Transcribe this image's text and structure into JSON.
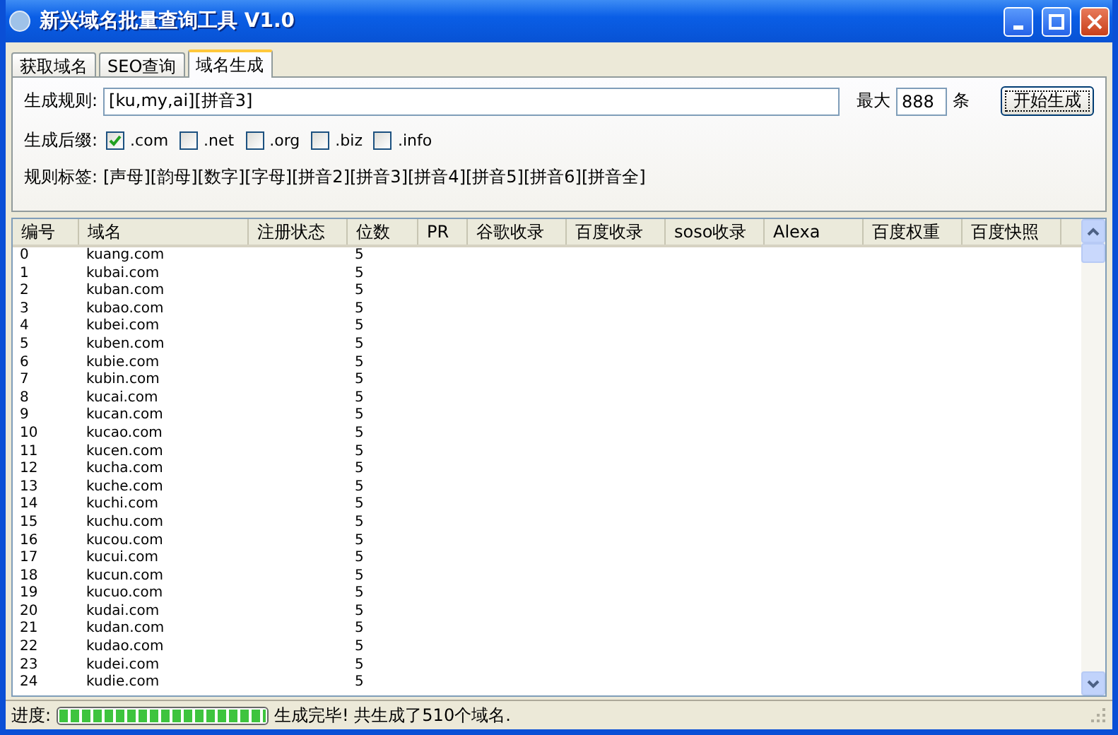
{
  "window": {
    "title": "新兴域名批量查询工具 V1.0"
  },
  "tabs": [
    {
      "label": "获取域名",
      "selected": false
    },
    {
      "label": "SEO查询",
      "selected": false
    },
    {
      "label": "域名生成",
      "selected": true
    }
  ],
  "rule": {
    "label": "生成规则:",
    "value": "[ku,my,ai][拼音3]",
    "max_label": "最大",
    "max_value": "888",
    "unit": "条",
    "button": "开始生成"
  },
  "suffixes": {
    "label": "生成后缀:",
    "items": [
      {
        "label": ".com",
        "checked": true
      },
      {
        "label": ".net",
        "checked": false
      },
      {
        "label": ".org",
        "checked": false
      },
      {
        "label": ".biz",
        "checked": false
      },
      {
        "label": ".info",
        "checked": false
      }
    ]
  },
  "tags": {
    "label": "规则标签:",
    "text": "[声母][韵母][数字][字母][拼音2][拼音3][拼音4][拼音5][拼音6][拼音全]"
  },
  "table": {
    "columns": [
      "编号",
      "域名",
      "注册状态",
      "位数",
      "PR",
      "谷歌收录",
      "百度收录",
      "soso收录",
      "Alexa",
      "百度权重",
      "百度快照"
    ],
    "rows": [
      {
        "no": "0",
        "domain": "kuang.com",
        "digits": "5"
      },
      {
        "no": "1",
        "domain": "kubai.com",
        "digits": "5"
      },
      {
        "no": "2",
        "domain": "kuban.com",
        "digits": "5"
      },
      {
        "no": "3",
        "domain": "kubao.com",
        "digits": "5"
      },
      {
        "no": "4",
        "domain": "kubei.com",
        "digits": "5"
      },
      {
        "no": "5",
        "domain": "kuben.com",
        "digits": "5"
      },
      {
        "no": "6",
        "domain": "kubie.com",
        "digits": "5"
      },
      {
        "no": "7",
        "domain": "kubin.com",
        "digits": "5"
      },
      {
        "no": "8",
        "domain": "kucai.com",
        "digits": "5"
      },
      {
        "no": "9",
        "domain": "kucan.com",
        "digits": "5"
      },
      {
        "no": "10",
        "domain": "kucao.com",
        "digits": "5"
      },
      {
        "no": "11",
        "domain": "kucen.com",
        "digits": "5"
      },
      {
        "no": "12",
        "domain": "kucha.com",
        "digits": "5"
      },
      {
        "no": "13",
        "domain": "kuche.com",
        "digits": "5"
      },
      {
        "no": "14",
        "domain": "kuchi.com",
        "digits": "5"
      },
      {
        "no": "15",
        "domain": "kuchu.com",
        "digits": "5"
      },
      {
        "no": "16",
        "domain": "kucou.com",
        "digits": "5"
      },
      {
        "no": "17",
        "domain": "kucui.com",
        "digits": "5"
      },
      {
        "no": "18",
        "domain": "kucun.com",
        "digits": "5"
      },
      {
        "no": "19",
        "domain": "kucuo.com",
        "digits": "5"
      },
      {
        "no": "20",
        "domain": "kudai.com",
        "digits": "5"
      },
      {
        "no": "21",
        "domain": "kudan.com",
        "digits": "5"
      },
      {
        "no": "22",
        "domain": "kudao.com",
        "digits": "5"
      },
      {
        "no": "23",
        "domain": "kudei.com",
        "digits": "5"
      },
      {
        "no": "24",
        "domain": "kudie.com",
        "digits": "5"
      }
    ]
  },
  "status_bar": {
    "label": "进度:",
    "progress": {
      "level": 1.0
    },
    "message": "生成完毕! 共生成了510个域名."
  }
}
